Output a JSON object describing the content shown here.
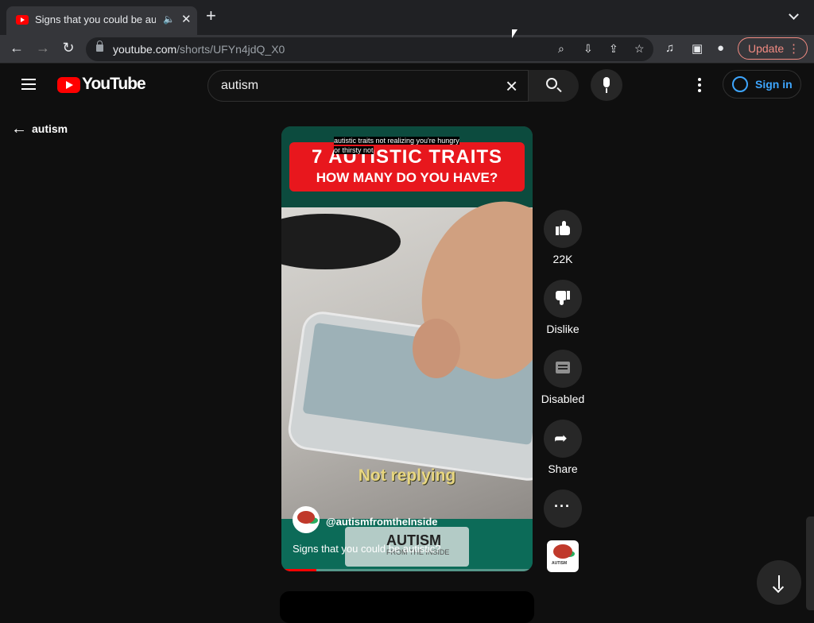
{
  "browser": {
    "tab_title": "Signs that you could be autistic?",
    "new_tab_label": "+",
    "url_host": "youtube.com",
    "url_path": "/shorts/UFYn4jdQ_X0",
    "update_label": "Update"
  },
  "youtube": {
    "logo_text": "YouTube",
    "search_value": "autism",
    "sign_in_label": "Sign in",
    "back_label": "autism"
  },
  "short": {
    "caption": "autistic traits not realizing you're hungry or thirsty not",
    "banner_line1": "7 AUTISTIC TRAITS",
    "banner_line2": "HOW MANY DO YOU HAVE?",
    "subtitle": "Not replying",
    "watermark_line1": "AUTISM",
    "watermark_line2": "FROM THE INSIDE",
    "channel": "@autismfromtheInside",
    "title": "Signs that you could be autistic?",
    "progress_fraction": 0.14
  },
  "actions": {
    "like_count": "22K",
    "dislike_label": "Dislike",
    "comments_label": "Disabled",
    "share_label": "Share"
  },
  "icons": [
    "youtube-favicon",
    "audio-icon",
    "close-icon",
    "back-arrow-icon",
    "forward-arrow-icon",
    "reload-icon",
    "lock-icon",
    "zoom-icon",
    "install-icon",
    "share-icon",
    "star-icon",
    "media-icon",
    "sidepanel-icon",
    "profile-icon",
    "menu-icon",
    "youtube-logo-icon",
    "clear-icon",
    "search-icon",
    "mic-icon",
    "kebab-icon",
    "account-icon",
    "like-icon",
    "dislike-icon",
    "comment-icon",
    "more-icon",
    "next-arrow-icon"
  ],
  "colors": {
    "youtube_red": "#ff0000",
    "link_blue": "#3ea6ff",
    "update_red": "#f28b82",
    "banner_red": "#e8171d",
    "teal": "#0c6b58"
  }
}
